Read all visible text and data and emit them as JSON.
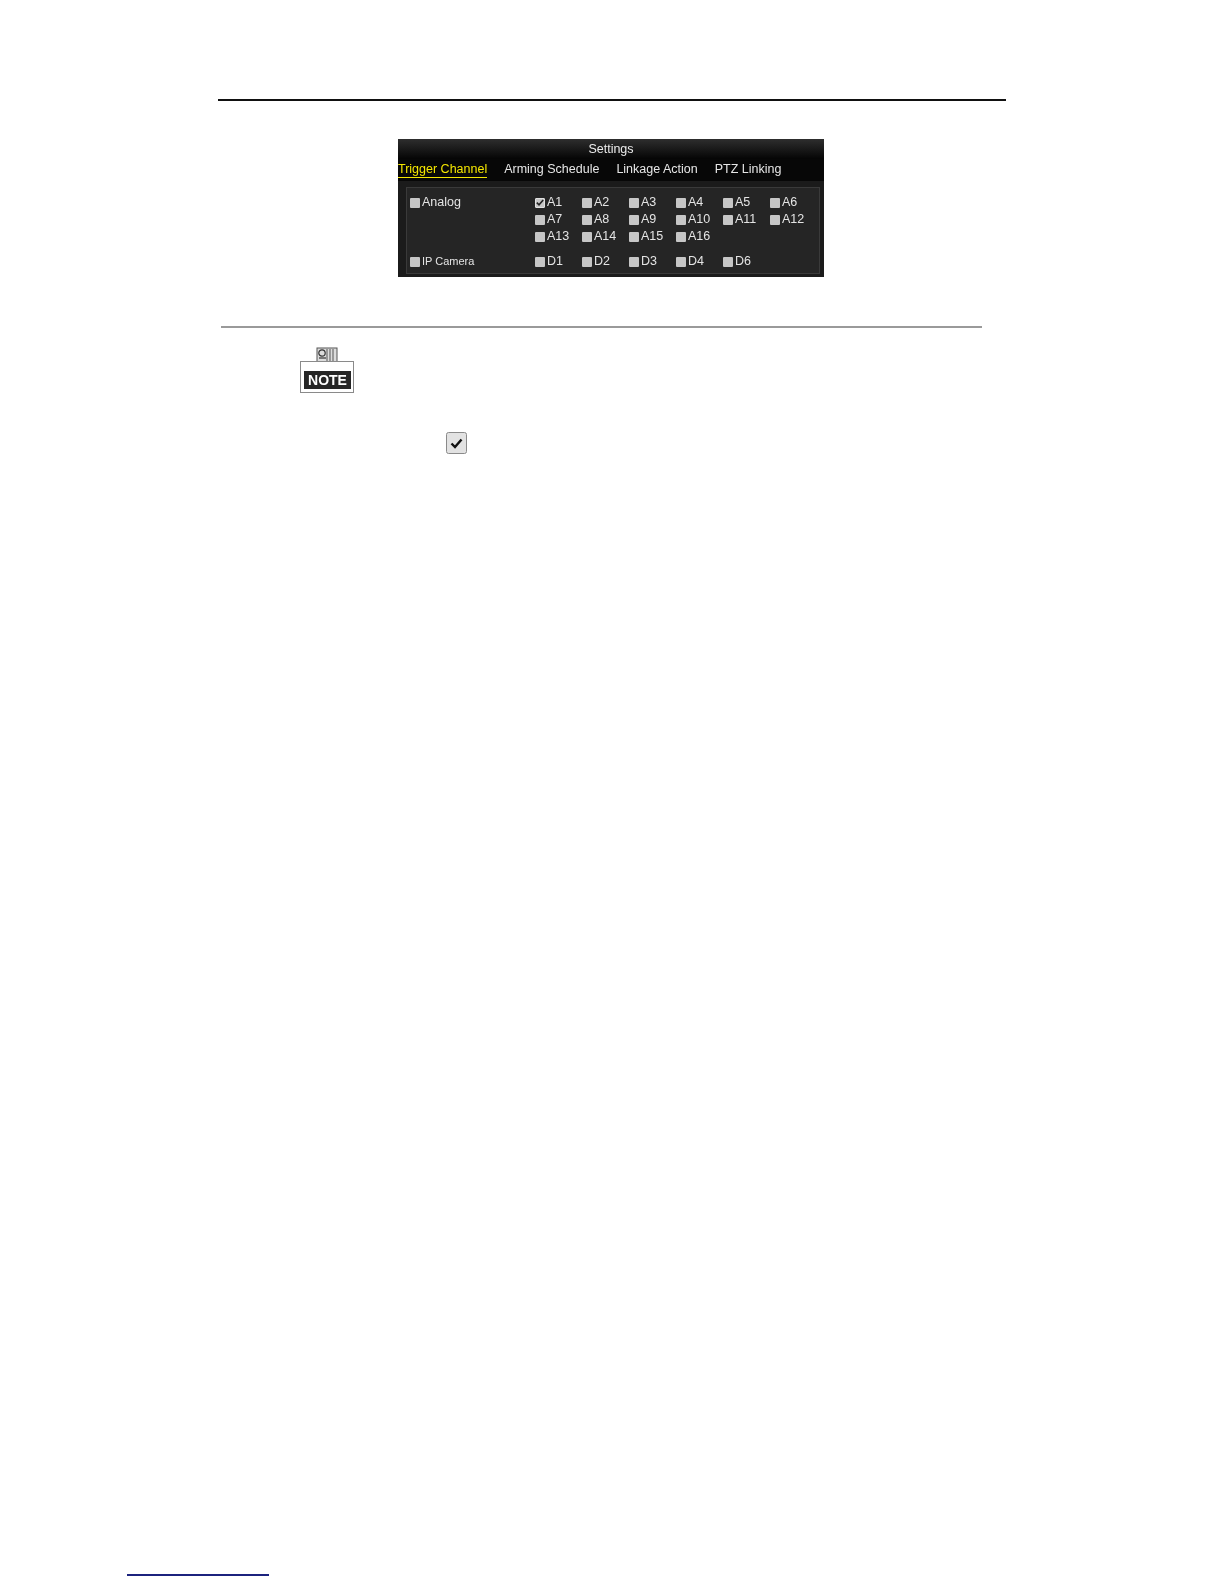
{
  "settings_dialog": {
    "title": "Settings",
    "tabs": [
      {
        "label": "Trigger Channel",
        "selected": true
      },
      {
        "label": "Arming Schedule",
        "selected": false
      },
      {
        "label": "Linkage Action",
        "selected": false
      },
      {
        "label": "PTZ Linking",
        "selected": false
      }
    ],
    "groups": [
      {
        "label": "Analog",
        "checked": false,
        "channels": [
          {
            "label": "A1",
            "checked": true
          },
          {
            "label": "A2",
            "checked": false
          },
          {
            "label": "A3",
            "checked": false
          },
          {
            "label": "A4",
            "checked": false
          },
          {
            "label": "A5",
            "checked": false
          },
          {
            "label": "A6",
            "checked": false
          },
          {
            "label": "A7",
            "checked": false
          },
          {
            "label": "A8",
            "checked": false
          },
          {
            "label": "A9",
            "checked": false
          },
          {
            "label": "A10",
            "checked": false
          },
          {
            "label": "A11",
            "checked": false
          },
          {
            "label": "A12",
            "checked": false
          },
          {
            "label": "A13",
            "checked": false
          },
          {
            "label": "A14",
            "checked": false
          },
          {
            "label": "A15",
            "checked": false
          },
          {
            "label": "A16",
            "checked": false
          }
        ]
      },
      {
        "label": "IP Camera",
        "checked": false,
        "channels": [
          {
            "label": "D1",
            "checked": false
          },
          {
            "label": "D2",
            "checked": false
          },
          {
            "label": "D3",
            "checked": false
          },
          {
            "label": "D4",
            "checked": false
          },
          {
            "label": "D6",
            "checked": false
          }
        ]
      }
    ]
  },
  "note": {
    "badge": "NOTE"
  }
}
